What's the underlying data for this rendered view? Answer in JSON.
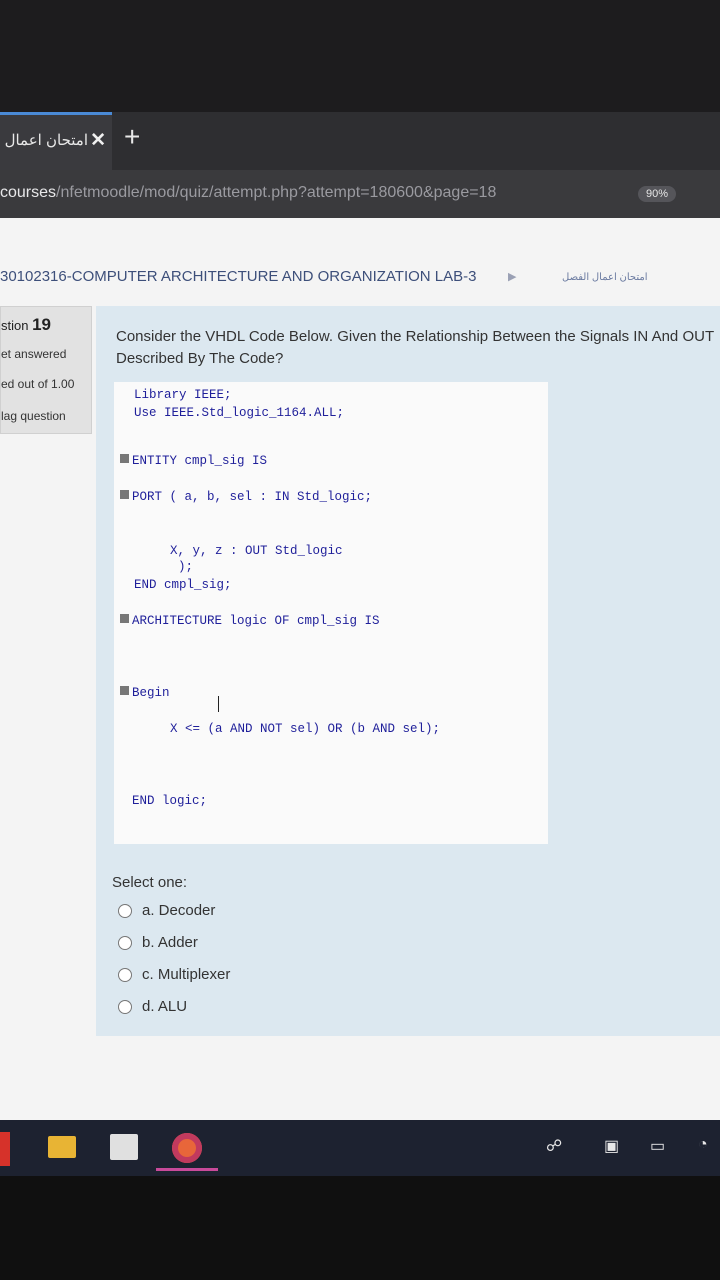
{
  "browser": {
    "tab_title": "امتحان اعمال",
    "tab_close": "✕",
    "new_tab": "+",
    "url_host": "courses",
    "url_path": "/nfetmoodle/mod/quiz/attempt.php?attempt=180600&page=18",
    "zoom": "90%"
  },
  "breadcrumb": {
    "course": "30102316-COMPUTER ARCHITECTURE AND ORGANIZATION LAB-3",
    "separator": "▶",
    "quiz": "امتحان اعمال الفصل"
  },
  "question_info": {
    "label": "stion",
    "number": "19",
    "status": "et answered",
    "mark": "ed out of 1.00",
    "flag": "lag question"
  },
  "question": {
    "text_line1": "Consider the VHDL Code Below. Given the Relationship Between the Signals IN And OUT",
    "text_line2": "Described By The Code?",
    "code": {
      "line1": "Library IEEE;",
      "line2": "Use IEEE.Std_logic_1164.ALL;",
      "line3": "ENTITY cmpl_sig IS",
      "line4": "PORT ( a, b, sel : IN Std_logic;",
      "line5": "X, y, z : OUT Std_logic",
      "line6": ");",
      "line7": "END cmpl_sig;",
      "line8": "ARCHITECTURE logic OF cmpl_sig IS",
      "line9": "Begin",
      "line10": "X <= (a AND NOT sel) OR (b AND sel);",
      "line11": "END logic;"
    },
    "select_label": "Select one:",
    "options": [
      {
        "label": "a. Decoder"
      },
      {
        "label": "b. Adder"
      },
      {
        "label": "c. Multiplexer"
      },
      {
        "label": "d. ALU"
      }
    ]
  },
  "taskbar": {
    "tray_icons": [
      "people-icon",
      "network-icon",
      "battery-icon",
      "wifi-icon"
    ]
  }
}
